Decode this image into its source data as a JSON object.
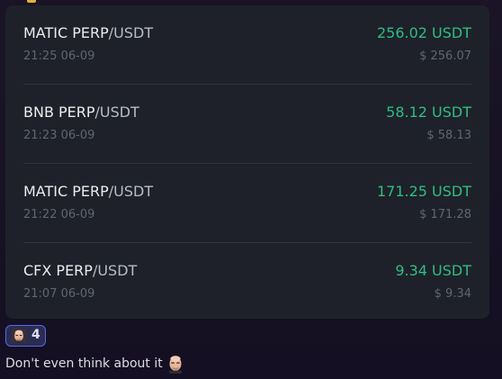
{
  "trades": [
    {
      "base": "MATIC PERP",
      "quote": "/USDT",
      "time": "21:25 06-09",
      "price": "256.02 USDT",
      "usd": "$ 256.07"
    },
    {
      "base": "BNB PERP",
      "quote": "/USDT",
      "time": "21:23 06-09",
      "price": "58.12 USDT",
      "usd": "$ 58.13"
    },
    {
      "base": "MATIC PERP",
      "quote": "/USDT",
      "time": "21:22 06-09",
      "price": "171.25 USDT",
      "usd": "$ 171.28"
    },
    {
      "base": "CFX PERP",
      "quote": "/USDT",
      "time": "21:07 06-09",
      "price": "9.34 USDT",
      "usd": "$ 9.34"
    }
  ],
  "reaction": {
    "emoji": "bald-man-face-emoji",
    "count": "4"
  },
  "message": {
    "text": "Don't even think about it",
    "emoji": "bald-man-face-emoji"
  },
  "colors": {
    "background": "#140f22",
    "card": "#1e2129",
    "price_up": "#2ebd85",
    "muted": "#5e6673",
    "reaction_border": "#5865f2"
  }
}
